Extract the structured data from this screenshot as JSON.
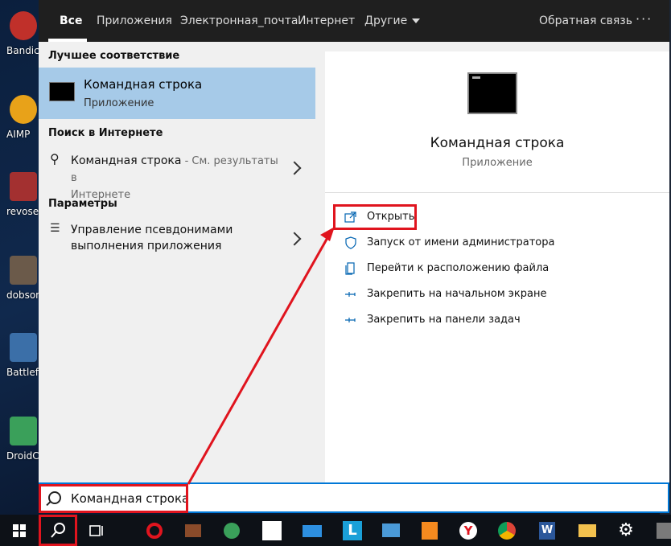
{
  "desktop": {
    "icons": [
      {
        "label": "Bandic",
        "color": "#c0302a"
      },
      {
        "label": "AIMP",
        "color": "#e8a219"
      },
      {
        "label": "revosetu",
        "color": "#a33030"
      },
      {
        "label": "dobson",
        "color": "#6b5a4a"
      },
      {
        "label": "Battlefie",
        "color": "#3b6fa8"
      },
      {
        "label": "DroidCa",
        "color": "#3aa05a"
      }
    ]
  },
  "tabs": {
    "all": "Все",
    "apps": "Приложения",
    "email": "Электронная_почта",
    "web": "Интернет",
    "other": "Другие",
    "feedback": "Обратная связь",
    "more": "···"
  },
  "left": {
    "best_match_title": "Лучшее соответствие",
    "best": {
      "title": "Командная строка",
      "subtitle": "Приложение"
    },
    "web_title": "Поиск в Интернете",
    "web_result": {
      "main": "Командная строка",
      "muted": " - См. результаты в",
      "line2": "Интернете"
    },
    "settings_title": "Параметры",
    "settings_result": {
      "line1": "Управление псевдонимами",
      "line2": "выполнения приложения"
    }
  },
  "right": {
    "title": "Командная строка",
    "subtitle": "Приложение",
    "actions": {
      "open": "Открыть",
      "run_admin": "Запуск от имени администратора",
      "file_location": "Перейти к расположению файла",
      "pin_start": "Закрепить на начальном экране",
      "pin_taskbar": "Закрепить на панели задач"
    }
  },
  "search": {
    "value": "Командная строка"
  },
  "colors": {
    "accent": "#0078d7",
    "highlight": "#e0141e",
    "selected": "#a6cae8"
  }
}
